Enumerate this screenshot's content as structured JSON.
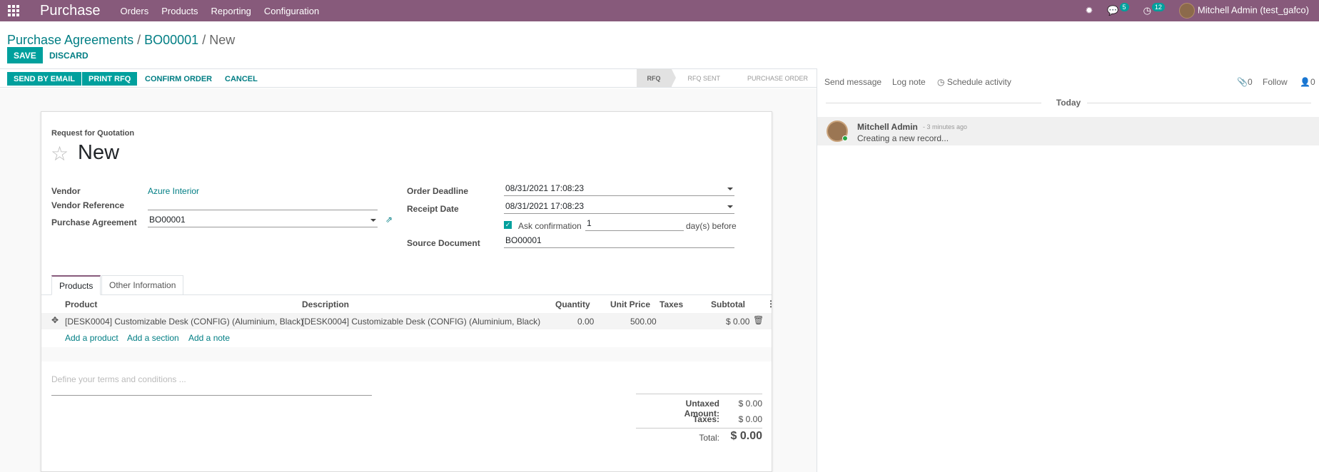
{
  "navbar": {
    "brand": "Purchase",
    "menus": [
      "Orders",
      "Products",
      "Reporting",
      "Configuration"
    ],
    "messages_badge": "5",
    "activities_badge": "12",
    "user": "Mitchell Admin (test_gafco)"
  },
  "breadcrumb": {
    "root": "Purchase Agreements",
    "parent": "BO00001",
    "current": "New"
  },
  "actions": {
    "save": "SAVE",
    "discard": "DISCARD"
  },
  "statusbar": {
    "send_email": "SEND BY EMAIL",
    "print_rfq": "PRINT RFQ",
    "confirm": "CONFIRM ORDER",
    "cancel": "CANCEL",
    "stages": [
      "RFQ",
      "RFQ SENT",
      "PURCHASE ORDER"
    ],
    "active_stage": "RFQ"
  },
  "form": {
    "doc_type": "Request for Quotation",
    "name": "New",
    "vendor_label": "Vendor",
    "vendor_value": "Azure Interior",
    "vendor_ref_label": "Vendor Reference",
    "vendor_ref_value": "",
    "agreement_label": "Purchase Agreement",
    "agreement_value": "BO00001",
    "order_deadline_label": "Order Deadline",
    "order_deadline_value": "08/31/2021 17:08:23",
    "receipt_date_label": "Receipt Date",
    "receipt_date_value": "08/31/2021 17:08:23",
    "ask_confirmation_label": "Ask confirmation",
    "ask_confirmation_checked": true,
    "ask_confirmation_days": "1",
    "days_before": "day(s) before",
    "source_doc_label": "Source Document",
    "source_doc_value": "BO00001"
  },
  "tabs": [
    "Products",
    "Other Information"
  ],
  "table": {
    "headers": [
      "Product",
      "Description",
      "Quantity",
      "Unit Price",
      "Taxes",
      "Subtotal"
    ],
    "rows": [
      {
        "product": "[DESK0004] Customizable Desk (CONFIG) (Aluminium, Black)",
        "description": "[DESK0004] Customizable Desk (CONFIG) (Aluminium, Black)",
        "quantity": "0.00",
        "unit_price": "500.00",
        "taxes": "",
        "subtotal": "$ 0.00"
      }
    ],
    "add_product": "Add a product",
    "add_section": "Add a section",
    "add_note": "Add a note"
  },
  "terms_placeholder": "Define your terms and conditions ...",
  "totals": {
    "untaxed_label": "Untaxed Amount:",
    "untaxed_value": "$ 0.00",
    "taxes_label": "Taxes:",
    "taxes_value": "$ 0.00",
    "total_label": "Total:",
    "total_value": "$ 0.00"
  },
  "chatter": {
    "send_message": "Send message",
    "log_note": "Log note",
    "schedule": "Schedule activity",
    "attachments": "0",
    "follow": "Follow",
    "followers": "0",
    "today": "Today",
    "author": "Mitchell Admin",
    "time": "- 3 minutes ago",
    "body": "Creating a new record..."
  },
  "colors": {
    "brand": "#875a7b",
    "accent": "#00a09d",
    "link": "#017e84"
  }
}
